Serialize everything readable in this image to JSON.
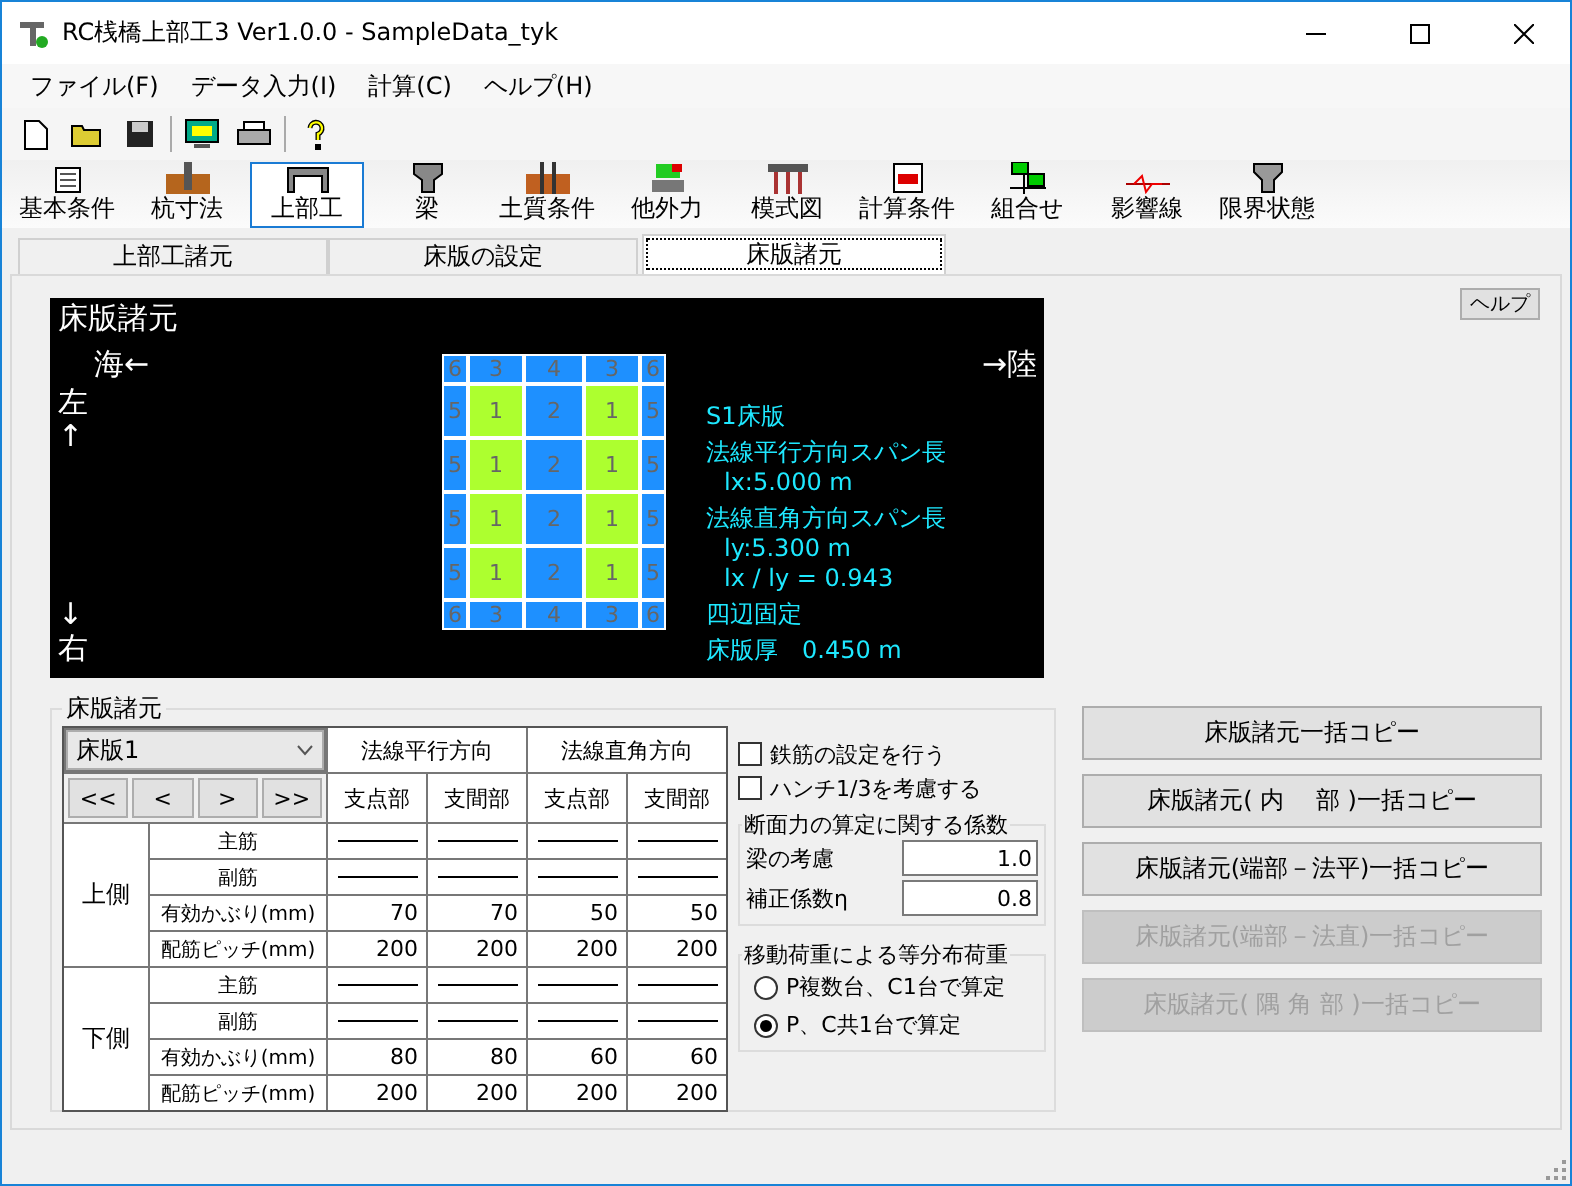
{
  "window": {
    "title": "RC桟橋上部工3 Ver1.0.0 - SampleData_tyk"
  },
  "menu": [
    {
      "label": "ファイル(F)"
    },
    {
      "label": "データ入力(I)"
    },
    {
      "label": "計算(C)"
    },
    {
      "label": "ヘルプ(H)"
    }
  ],
  "ribbon": [
    {
      "label": "基本条件",
      "selected": false
    },
    {
      "label": "杭寸法",
      "selected": false
    },
    {
      "label": "上部工",
      "selected": true
    },
    {
      "label": "梁",
      "selected": false
    },
    {
      "label": "土質条件",
      "selected": false
    },
    {
      "label": "他外力",
      "selected": false
    },
    {
      "label": "模式図",
      "selected": false
    },
    {
      "label": "計算条件",
      "selected": false
    },
    {
      "label": "組合せ",
      "selected": false
    },
    {
      "label": "影響線",
      "selected": false
    },
    {
      "label": "限界状態",
      "selected": false
    }
  ],
  "tabs": [
    {
      "label": "上部工諸元",
      "selected": false
    },
    {
      "label": "床版の設定",
      "selected": false
    },
    {
      "label": "床版諸元",
      "selected": true
    }
  ],
  "help_button": "ヘルプ",
  "diagram": {
    "title": "床版諸元",
    "sea_label": "海←",
    "land_label": "→陸",
    "left_label": "左↑",
    "right_label": "↓右",
    "grid": [
      [
        {
          "label": "6",
          "color": "#1e90ff"
        },
        {
          "label": "3",
          "color": "#1e90ff"
        },
        {
          "label": "4",
          "color": "#1e90ff"
        },
        {
          "label": "3",
          "color": "#1e90ff"
        },
        {
          "label": "6",
          "color": "#1e90ff"
        }
      ],
      [
        {
          "label": "5",
          "color": "#1e90ff"
        },
        {
          "label": "1",
          "color": "#adff2f"
        },
        {
          "label": "2",
          "color": "#1e90ff"
        },
        {
          "label": "1",
          "color": "#adff2f"
        },
        {
          "label": "5",
          "color": "#1e90ff"
        }
      ],
      [
        {
          "label": "5",
          "color": "#1e90ff"
        },
        {
          "label": "1",
          "color": "#adff2f"
        },
        {
          "label": "2",
          "color": "#1e90ff"
        },
        {
          "label": "1",
          "color": "#adff2f"
        },
        {
          "label": "5",
          "color": "#1e90ff"
        }
      ],
      [
        {
          "label": "5",
          "color": "#1e90ff"
        },
        {
          "label": "1",
          "color": "#adff2f"
        },
        {
          "label": "2",
          "color": "#1e90ff"
        },
        {
          "label": "1",
          "color": "#adff2f"
        },
        {
          "label": "5",
          "color": "#1e90ff"
        }
      ],
      [
        {
          "label": "5",
          "color": "#1e90ff"
        },
        {
          "label": "1",
          "color": "#adff2f"
        },
        {
          "label": "2",
          "color": "#1e90ff"
        },
        {
          "label": "1",
          "color": "#adff2f"
        },
        {
          "label": "5",
          "color": "#1e90ff"
        }
      ],
      [
        {
          "label": "6",
          "color": "#1e90ff"
        },
        {
          "label": "3",
          "color": "#1e90ff"
        },
        {
          "label": "4",
          "color": "#1e90ff"
        },
        {
          "label": "3",
          "color": "#1e90ff"
        },
        {
          "label": "6",
          "color": "#1e90ff"
        }
      ]
    ],
    "info": [
      {
        "text": "S1床版",
        "kind": "heading"
      },
      {
        "text": "法線平行方向スパン長",
        "kind": "heading"
      },
      {
        "text": "lx:5.000 m",
        "kind": "value"
      },
      {
        "text": "法線直角方向スパン長",
        "kind": "heading"
      },
      {
        "text": "ly:5.300 m",
        "kind": "value"
      },
      {
        "text": "lx / ly = 0.943",
        "kind": "value"
      },
      {
        "text": "四辺固定",
        "kind": "heading"
      },
      {
        "text": "床版厚　0.450 m",
        "kind": "heading"
      }
    ]
  },
  "slab_group": {
    "title": "床版諸元",
    "select": "床版1",
    "nav_buttons": [
      "<<",
      "<",
      ">",
      ">>"
    ],
    "column_groups": [
      "法線平行方向",
      "法線直角方向"
    ],
    "columns": [
      "支点部",
      "支間部",
      "支点部",
      "支間部"
    ],
    "sections": [
      {
        "label": "上側",
        "rows": [
          {
            "label": "主筋",
            "kind": "line"
          },
          {
            "label": "副筋",
            "kind": "line"
          },
          {
            "label": "有効かぶり(mm)",
            "kind": "values",
            "values": [
              "70",
              "70",
              "50",
              "50"
            ]
          },
          {
            "label": "配筋ピッチ(mm)",
            "kind": "values",
            "values": [
              "200",
              "200",
              "200",
              "200"
            ]
          }
        ]
      },
      {
        "label": "下側",
        "rows": [
          {
            "label": "主筋",
            "kind": "line"
          },
          {
            "label": "副筋",
            "kind": "line"
          },
          {
            "label": "有効かぶり(mm)",
            "kind": "values",
            "values": [
              "80",
              "80",
              "60",
              "60"
            ]
          },
          {
            "label": "配筋ピッチ(mm)",
            "kind": "values",
            "values": [
              "200",
              "200",
              "200",
              "200"
            ]
          }
        ]
      }
    ],
    "checkboxes": [
      {
        "label": "鉄筋の設定を行う",
        "checked": false
      },
      {
        "label": "ハンチ1/3を考慮する",
        "checked": false
      }
    ],
    "coefficients": {
      "title": "断面力の算定に関する係数",
      "fields": [
        {
          "label": "梁の考慮",
          "value": "1.0"
        },
        {
          "label": "補正係数η",
          "value": "0.8"
        }
      ]
    },
    "moving_load": {
      "title": "移動荷重による等分布荷重",
      "options": [
        {
          "label": "P複数台、C1台で算定",
          "selected": false
        },
        {
          "label": "P、C共1台で算定",
          "selected": true
        }
      ]
    }
  },
  "copy_buttons": [
    {
      "label": "床版諸元一括コピー",
      "disabled": false
    },
    {
      "label": "床版諸元( 内　 部 )一括コピー",
      "disabled": false
    },
    {
      "label": "床版諸元(端部－法平)一括コピー",
      "disabled": false
    },
    {
      "label": "床版諸元(端部－法直)一括コピー",
      "disabled": true
    },
    {
      "label": "床版諸元( 隅 角 部 )一括コピー",
      "disabled": true
    }
  ]
}
